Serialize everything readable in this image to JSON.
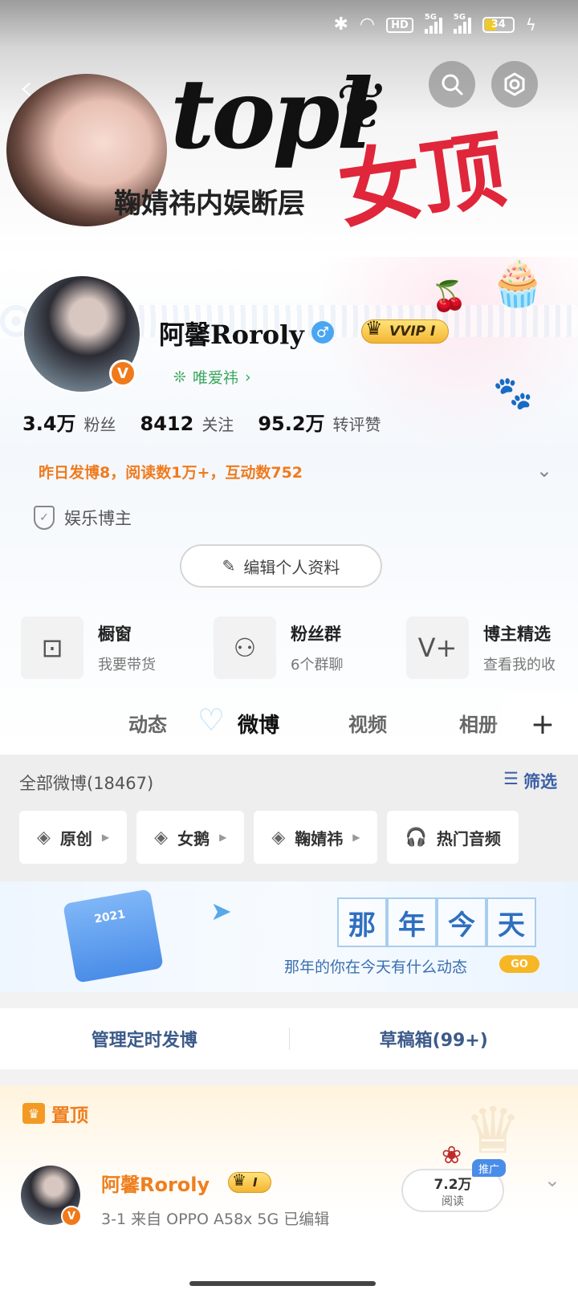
{
  "status_bar": {
    "bluetooth_icon": "bluetooth-icon",
    "wifi_icon": "wifi-icon",
    "hd_label": "HD",
    "signal1_label": "5G",
    "signal2_label": "5G",
    "battery_level": "34",
    "charging_icon": "bolt-icon"
  },
  "banner": {
    "logo_text": "topl",
    "red_text": "女顶",
    "subtitle": "鞠婧祎内娱断层"
  },
  "header": {
    "back_icon": "chevron-left-icon",
    "search_icon": "search-icon",
    "settings_icon": "gear-icon"
  },
  "profile": {
    "username": "阿馨Roroly",
    "gender_icon": "male-icon",
    "gender_symbol": "♂",
    "vip_label": "VVIP I",
    "verified_symbol": "V",
    "fan_tag": "唯爱祎",
    "stats": [
      {
        "num": "3.4万",
        "label": "粉丝"
      },
      {
        "num": "8412",
        "label": "关注"
      },
      {
        "num": "95.2万",
        "label": "转评赞"
      }
    ],
    "activity": "昨日发博8，阅读数1万+，互动数752",
    "blogger_tag": "娱乐博主",
    "edit_button": "编辑个人资料"
  },
  "services": [
    {
      "title": "橱窗",
      "sub": "我要带货",
      "icon": "shopping-bag-icon"
    },
    {
      "title": "粉丝群",
      "sub": "6个群聊",
      "icon": "group-icon"
    },
    {
      "title": "博主精选",
      "sub": "查看我的收",
      "icon": "v-plus-icon"
    }
  ],
  "tabs": [
    {
      "label": "动态"
    },
    {
      "label": "微博"
    },
    {
      "label": "视频"
    },
    {
      "label": "相册"
    }
  ],
  "feed": {
    "count_label": "全部微博(18467)",
    "filter_label": "筛选",
    "chips": [
      {
        "label": "原创"
      },
      {
        "label": "女鹅"
      },
      {
        "label": "鞠婧祎"
      },
      {
        "label": "热门音频"
      }
    ]
  },
  "memory": {
    "calendar_year": "2021",
    "title_chars": [
      "那",
      "年",
      "今",
      "天"
    ],
    "subtitle": "那年的你在今天有什么动态",
    "go_label": "GO"
  },
  "manage": {
    "scheduled": "管理定时发博",
    "drafts": "草稿箱(99+)"
  },
  "pinned": {
    "label": "置顶",
    "author": "阿馨Roroly",
    "badge": "I",
    "meta": "3-1  来自 OPPO A58x 5G  已编辑",
    "reads_num": "7.2万",
    "reads_label": "阅读",
    "promo_label": "推广"
  },
  "colors": {
    "accent_orange": "#ee7f1e",
    "link_blue": "#3c5fa6",
    "verified_orange": "#f07a1a"
  }
}
